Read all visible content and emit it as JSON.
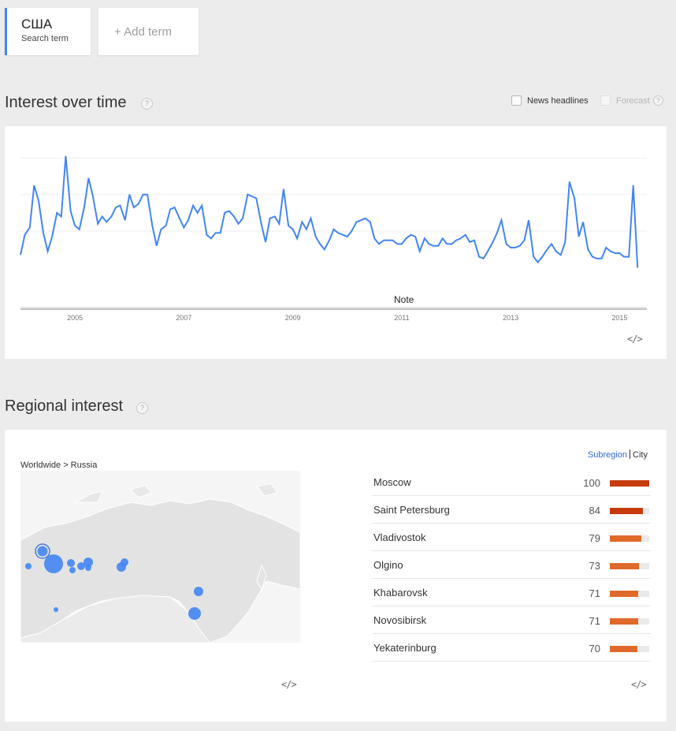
{
  "term": {
    "title": "США",
    "subtitle": "Search term"
  },
  "add_term": {
    "label": "+ Add term"
  },
  "interest_over_time": {
    "title": "Interest over time",
    "help": "?",
    "news_headlines_label": "News headlines",
    "forecast_label": "Forecast",
    "note_label": "Note",
    "embed_label": "</>",
    "line_color": "#4285f4"
  },
  "chart_data": {
    "type": "line",
    "title": "",
    "xlabel": "",
    "ylabel": "",
    "x_tick_labels": [
      "2005",
      "2007",
      "2009",
      "2011",
      "2013",
      "2015"
    ],
    "x_ticks": [
      2005,
      2007,
      2009,
      2011,
      2013,
      2015
    ],
    "xlim": [
      2004.0,
      2015.5
    ],
    "ylim": [
      0,
      100
    ],
    "grid": true,
    "series": [
      {
        "values": [
          [
            2004.0,
            46
          ],
          [
            2004.08,
            57
          ],
          [
            2004.17,
            61
          ],
          [
            2004.25,
            84
          ],
          [
            2004.33,
            76
          ],
          [
            2004.42,
            58
          ],
          [
            2004.5,
            48
          ],
          [
            2004.58,
            56
          ],
          [
            2004.67,
            69
          ],
          [
            2004.75,
            67
          ],
          [
            2004.83,
            100
          ],
          [
            2004.92,
            70
          ],
          [
            2005.0,
            62
          ],
          [
            2005.08,
            60
          ],
          [
            2005.17,
            72
          ],
          [
            2005.25,
            88
          ],
          [
            2005.33,
            78
          ],
          [
            2005.42,
            63
          ],
          [
            2005.5,
            67
          ],
          [
            2005.58,
            64
          ],
          [
            2005.67,
            67
          ],
          [
            2005.75,
            72
          ],
          [
            2005.83,
            73
          ],
          [
            2005.92,
            65
          ],
          [
            2006.0,
            79
          ],
          [
            2006.08,
            72
          ],
          [
            2006.17,
            74
          ],
          [
            2006.25,
            79
          ],
          [
            2006.33,
            79
          ],
          [
            2006.42,
            62
          ],
          [
            2006.5,
            51
          ],
          [
            2006.58,
            60
          ],
          [
            2006.67,
            62
          ],
          [
            2006.75,
            71
          ],
          [
            2006.83,
            72
          ],
          [
            2006.92,
            66
          ],
          [
            2007.0,
            61
          ],
          [
            2007.08,
            65
          ],
          [
            2007.17,
            73
          ],
          [
            2007.25,
            69
          ],
          [
            2007.33,
            73
          ],
          [
            2007.42,
            57
          ],
          [
            2007.5,
            55
          ],
          [
            2007.58,
            58
          ],
          [
            2007.67,
            58
          ],
          [
            2007.75,
            69
          ],
          [
            2007.83,
            70
          ],
          [
            2007.92,
            67
          ],
          [
            2008.0,
            63
          ],
          [
            2008.08,
            66
          ],
          [
            2008.17,
            79
          ],
          [
            2008.25,
            78
          ],
          [
            2008.33,
            77
          ],
          [
            2008.42,
            63
          ],
          [
            2008.5,
            53
          ],
          [
            2008.58,
            66
          ],
          [
            2008.67,
            67
          ],
          [
            2008.75,
            63
          ],
          [
            2008.83,
            82
          ],
          [
            2008.92,
            62
          ],
          [
            2009.0,
            60
          ],
          [
            2009.08,
            55
          ],
          [
            2009.17,
            64
          ],
          [
            2009.25,
            60
          ],
          [
            2009.33,
            66
          ],
          [
            2009.42,
            56
          ],
          [
            2009.5,
            52
          ],
          [
            2009.58,
            49
          ],
          [
            2009.67,
            54
          ],
          [
            2009.75,
            60
          ],
          [
            2009.83,
            58
          ],
          [
            2009.92,
            57
          ],
          [
            2010.0,
            56
          ],
          [
            2010.08,
            59
          ],
          [
            2010.17,
            64
          ],
          [
            2010.25,
            65
          ],
          [
            2010.33,
            66
          ],
          [
            2010.42,
            64
          ],
          [
            2010.5,
            55
          ],
          [
            2010.58,
            52
          ],
          [
            2010.67,
            54
          ],
          [
            2010.75,
            54
          ],
          [
            2010.83,
            54
          ],
          [
            2010.92,
            52
          ],
          [
            2011.0,
            52
          ],
          [
            2011.08,
            55
          ],
          [
            2011.17,
            57
          ],
          [
            2011.25,
            56
          ],
          [
            2011.33,
            48
          ],
          [
            2011.42,
            55
          ],
          [
            2011.5,
            52
          ],
          [
            2011.58,
            51
          ],
          [
            2011.67,
            51
          ],
          [
            2011.75,
            55
          ],
          [
            2011.83,
            52
          ],
          [
            2011.92,
            52
          ],
          [
            2012.0,
            54
          ],
          [
            2012.08,
            55
          ],
          [
            2012.17,
            57
          ],
          [
            2012.25,
            53
          ],
          [
            2012.33,
            54
          ],
          [
            2012.42,
            45
          ],
          [
            2012.5,
            44
          ],
          [
            2012.58,
            48
          ],
          [
            2012.67,
            53
          ],
          [
            2012.75,
            58
          ],
          [
            2012.83,
            65
          ],
          [
            2012.92,
            52
          ],
          [
            2013.0,
            50
          ],
          [
            2013.08,
            50
          ],
          [
            2013.17,
            51
          ],
          [
            2013.25,
            54
          ],
          [
            2013.33,
            65
          ],
          [
            2013.42,
            45
          ],
          [
            2013.5,
            42
          ],
          [
            2013.58,
            45
          ],
          [
            2013.67,
            49
          ],
          [
            2013.75,
            52
          ],
          [
            2013.83,
            48
          ],
          [
            2013.92,
            46
          ],
          [
            2014.0,
            53
          ],
          [
            2014.08,
            86
          ],
          [
            2014.17,
            77
          ],
          [
            2014.25,
            56
          ],
          [
            2014.33,
            64
          ],
          [
            2014.42,
            49
          ],
          [
            2014.5,
            45
          ],
          [
            2014.58,
            44
          ],
          [
            2014.67,
            44
          ],
          [
            2014.75,
            50
          ],
          [
            2014.83,
            48
          ],
          [
            2014.92,
            47
          ],
          [
            2015.0,
            47
          ],
          [
            2015.08,
            45
          ],
          [
            2015.17,
            45
          ],
          [
            2015.25,
            84
          ],
          [
            2015.33,
            39
          ]
        ]
      }
    ]
  },
  "regional_interest": {
    "title": "Regional interest",
    "help": "?",
    "breadcrumb": "Worldwide > Russia",
    "toggle_active": "Subregion",
    "toggle_other": "City",
    "embed_label": "</>",
    "bubble_color": "#4285f4",
    "rows": [
      {
        "name": "Moscow",
        "value": 100,
        "color": "#c53b0b"
      },
      {
        "name": "Saint Petersburg",
        "value": 84,
        "color": "#c53b0b"
      },
      {
        "name": "Vladivostok",
        "value": 79,
        "color": "#e06a2a"
      },
      {
        "name": "Olgino",
        "value": 73,
        "color": "#e06a2a"
      },
      {
        "name": "Khabarovsk",
        "value": 71,
        "color": "#e06a2a"
      },
      {
        "name": "Novosibirsk",
        "value": 71,
        "color": "#e06a2a"
      },
      {
        "name": "Yekaterinburg",
        "value": 70,
        "color": "#e06a2a"
      }
    ]
  }
}
